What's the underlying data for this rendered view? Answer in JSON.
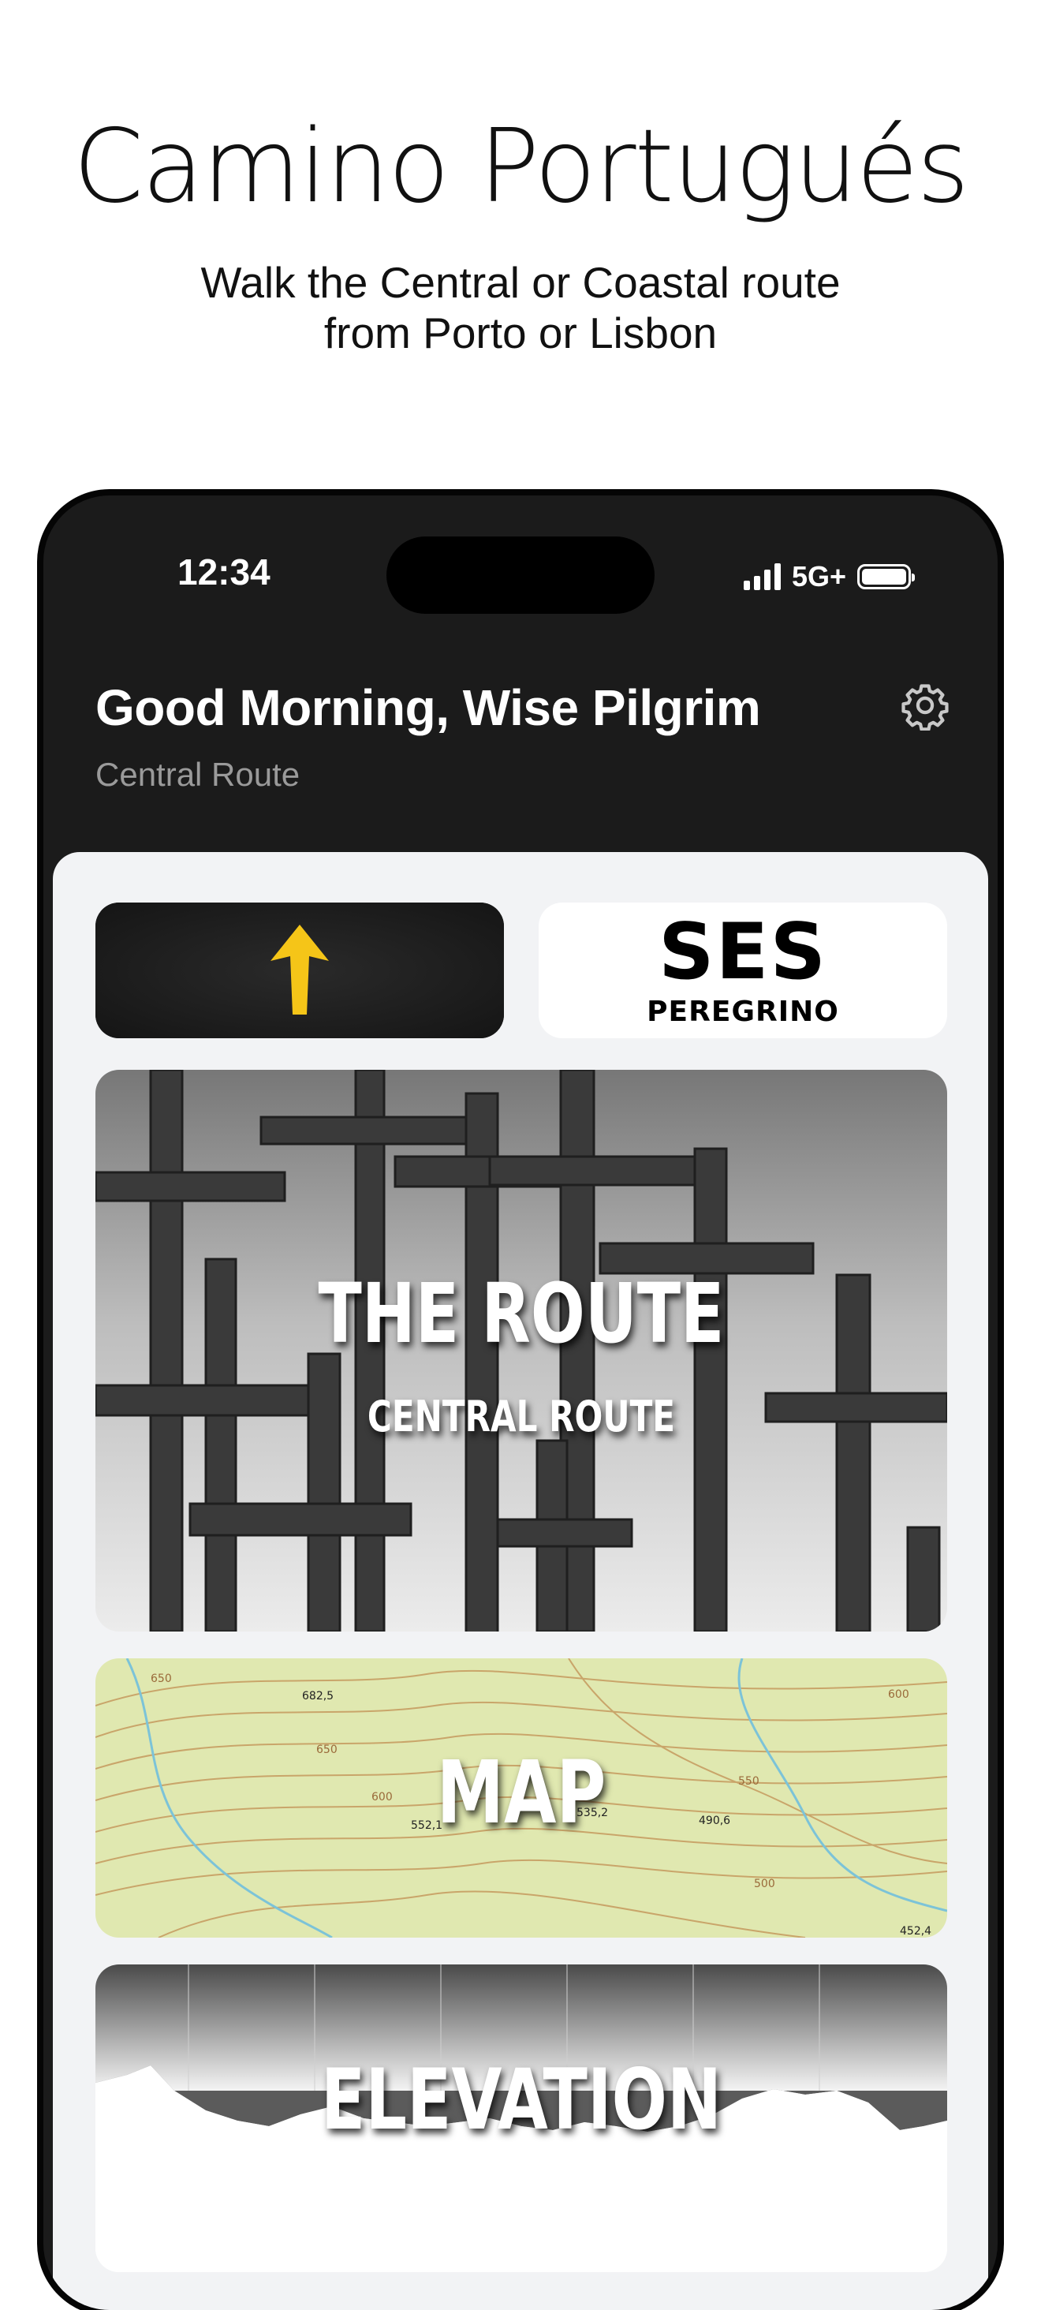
{
  "marketing": {
    "headline": "Camino Portugués",
    "subline_1": "Walk the Central or Coastal route",
    "subline_2": "from Porto or Lisbon"
  },
  "status_bar": {
    "time": "12:34",
    "network": "5G+",
    "battery_level": 1.0
  },
  "header": {
    "greeting": "Good Morning, Wise Pilgrim",
    "route": "Central Route",
    "settings_icon": "gear-icon"
  },
  "tiles": {
    "arrow_icon": "yellow-arrow-icon",
    "ses_title": "SES",
    "ses_subtitle": "PEREGRINO",
    "route_title": "THE ROUTE",
    "route_subtitle": "CENTRAL ROUTE",
    "map_title": "MAP",
    "elevation_title": "ELEVATION"
  },
  "map_labels": [
    "682,5",
    "650",
    "650",
    "600",
    "552,1",
    "535,2",
    "490,6",
    "550",
    "500",
    "600",
    "452,4"
  ],
  "colors": {
    "arrow_yellow": "#f5c518",
    "dark_bg": "#1b1b1b",
    "content_bg": "#f2f3f5"
  }
}
